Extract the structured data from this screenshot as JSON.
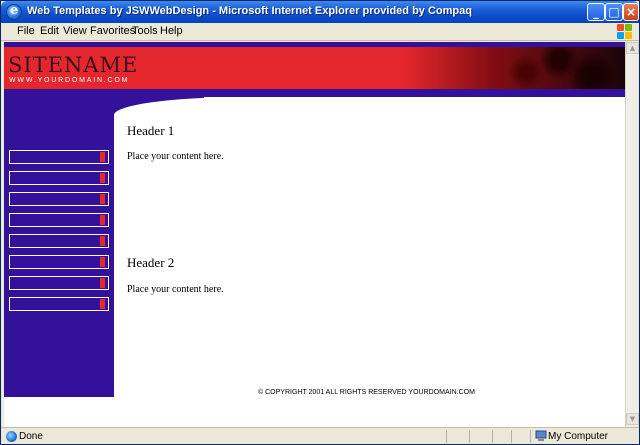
{
  "window": {
    "title": "Web Templates by JSWWebDesign - Microsoft Internet Explorer provided by Compaq",
    "minimize": "_",
    "maximize": "□",
    "close": "×"
  },
  "menu": {
    "items": [
      "File",
      "Edit",
      "View",
      "Favorites",
      "Tools",
      "Help"
    ]
  },
  "page": {
    "site_name": "SITENAME",
    "site_url": "WWW.YOURDOMAIN.COM",
    "nav_button_count_visible": 8,
    "sections": [
      {
        "header": "Header 1",
        "body": "Place your content here."
      },
      {
        "header": "Header 2",
        "body": "Place your content here."
      }
    ],
    "copyright": "© COPYRIGHT 2001 ALL RIGHTS RESERVED YOURDOMAIN.COM"
  },
  "status": {
    "text": "Done",
    "zone": "My Computer"
  },
  "colors": {
    "brand_blue": "#33119a",
    "brand_red": "#e3272c"
  }
}
